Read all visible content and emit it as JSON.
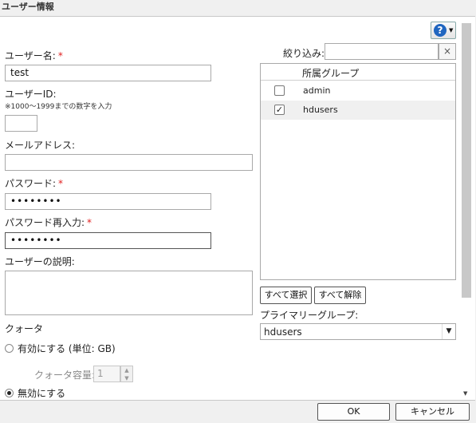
{
  "window": {
    "title": "ユーザー情報"
  },
  "form": {
    "username": {
      "label": "ユーザー名:",
      "required": "*",
      "value": "test"
    },
    "userid": {
      "label": "ユーザーID:",
      "hint": "※1000～1999までの数字を入力",
      "value": ""
    },
    "email": {
      "label": "メールアドレス:",
      "value": ""
    },
    "password": {
      "label": "パスワード:",
      "required": "*",
      "value": "••••••••"
    },
    "password_confirm": {
      "label": "パスワード再入力:",
      "required": "*",
      "value": "••••••••"
    },
    "description": {
      "label": "ユーザーの説明:",
      "value": ""
    },
    "quota": {
      "label": "クォータ",
      "enable_label": "有効にする (単位: GB)",
      "capacity_label": "クォータ容量:",
      "capacity_value": "1",
      "disable_label": "無効にする",
      "selected": "disable"
    }
  },
  "groups": {
    "filter_label": "絞り込み:",
    "filter_value": "",
    "clear_icon": "×",
    "column_header": "所属グループ",
    "items": [
      {
        "name": "admin",
        "checked": false,
        "mark": ""
      },
      {
        "name": "hdusers",
        "checked": true,
        "mark": "✓"
      }
    ],
    "select_all": "すべて選択",
    "deselect_all": "すべて解除",
    "primary_label": "プライマリーグループ:",
    "primary_value": "hdusers"
  },
  "help_icon": "?",
  "footer": {
    "ok": "OK",
    "cancel": "キャンセル"
  }
}
